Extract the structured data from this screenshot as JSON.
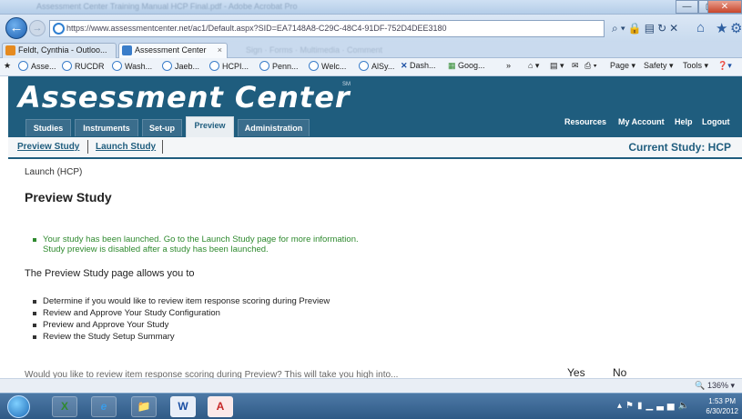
{
  "browser": {
    "window_title": "Assessment Center Training Manual HCP Final.pdf - Adobe Acrobat Pro",
    "url": "https://www.assessmentcenter.net/ac1/Default.aspx?SID=EA7148A8-C29C-48C4-91DF-752D4DEE3180",
    "tabs": [
      {
        "label": "Feldt, Cynthia - Outloo...",
        "color": "#e58a1f"
      },
      {
        "label": "Assessment Center",
        "color": "#3a7dc9"
      }
    ],
    "ghost_toolbar": "Sign  ·  Forms  ·  Multimedia  ·  Comment",
    "favorites": [
      "Asse...",
      "RUCDR",
      "Wash...",
      "Jaeb...",
      "HCPI...",
      "Penn...",
      "Welc...",
      "AlSy...",
      "Dash...",
      "Goog..."
    ],
    "command_bar": {
      "page": "Page ▾",
      "safety": "Safety ▾",
      "tools": "Tools ▾"
    },
    "window_buttons": {
      "minimize": "—",
      "maximize": "▢",
      "close": "✕"
    },
    "status_zoom": "🔍 136%  ▾"
  },
  "site": {
    "brand": "Assessment Center",
    "brand_mark": "SM",
    "nav_tabs": [
      "Studies",
      "Instruments",
      "Set-up",
      "Preview",
      "Administration"
    ],
    "active_tab": "Preview",
    "utility_links": [
      "Resources",
      "My Account",
      "Help",
      "Logout"
    ],
    "accent_color": "#1f5d7e"
  },
  "subnav": {
    "links": [
      "Preview Study",
      "Launch Study"
    ],
    "current_study": "Current Study: HCP"
  },
  "content": {
    "breadcrumb": "Launch (HCP)",
    "title": "Preview Study",
    "notice_line1": "Your study has been launched. Go to the Launch Study page for more information.",
    "notice_line2": "Study preview is disabled after a study has been launched.",
    "intro": "The Preview Study page allows you to",
    "items": [
      "Determine if you would like to review item response scoring during Preview",
      "Review and Approve Your Study Configuration",
      "Preview and Approve Your Study",
      "Review the Study Setup Summary"
    ],
    "cut_off_row": "Would you like to review item response scoring during Preview? This will take you high into...",
    "yes_label": "Yes",
    "no_label": "No"
  },
  "taskbar": {
    "apps": [
      "X",
      "e",
      "📁",
      "W",
      "A"
    ],
    "time": "1:53 PM",
    "date": "6/30/2012"
  }
}
